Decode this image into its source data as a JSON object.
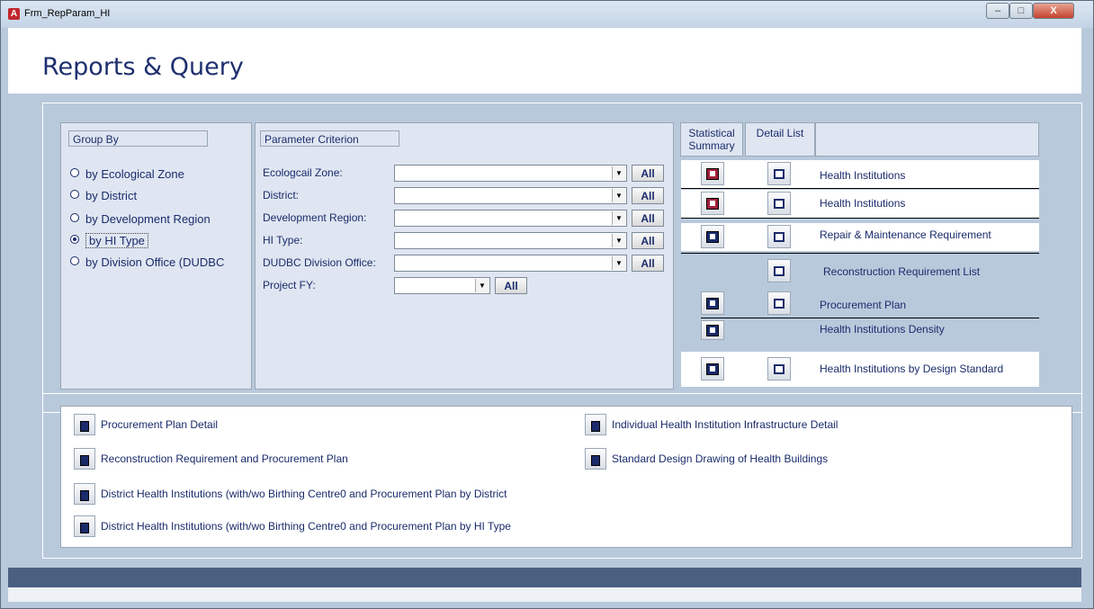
{
  "window": {
    "title": "Frm_RepParam_HI",
    "app_icon": "A",
    "minimize": "–",
    "maximize": "□",
    "close": "X"
  },
  "header": {
    "title": "Reports & Query"
  },
  "group_by": {
    "label": "Group By",
    "options": [
      {
        "label": "by Ecological Zone",
        "selected": false
      },
      {
        "label": "by District",
        "selected": false
      },
      {
        "label": "by Development Region",
        "selected": false
      },
      {
        "label": "by HI Type",
        "selected": true
      },
      {
        "label": "by Division Office (DUDBC",
        "selected": false
      }
    ]
  },
  "parameters": {
    "label": "Parameter Criterion",
    "all_label": "All",
    "fields": [
      {
        "label": "Ecologcail Zone:",
        "value": ""
      },
      {
        "label": "District:",
        "value": ""
      },
      {
        "label": "Development Region:",
        "value": ""
      },
      {
        "label": "HI Type:",
        "value": ""
      },
      {
        "label": "DUDBC Division Office:",
        "value": ""
      },
      {
        "label": "Project FY:",
        "value": ""
      }
    ]
  },
  "reports": {
    "col_stat": "Statistical Summary",
    "col_detail": "Detail List",
    "rows": [
      {
        "label": "Health Institutions"
      },
      {
        "label": "Health Institutions"
      },
      {
        "label": "Repair & Maintenance Requirement"
      },
      {
        "label": "Reconstruction Requirement List"
      },
      {
        "label": "Procurement Plan"
      },
      {
        "label": "Health Institutions Density"
      },
      {
        "label": "Health Institutions by Design Standard"
      }
    ]
  },
  "documents": {
    "left": [
      "Procurement Plan Detail",
      "Reconstruction Requirement and Procurement Plan",
      "District Health Institutions (with/wo Birthing Centre0 and Procurement Plan by District",
      "District Health Institutions (with/wo Birthing Centre0 and Procurement Plan by HI Type"
    ],
    "right": [
      "Individual Health Institution Infrastructure Detail",
      "Standard Design Drawing of Health Buildings"
    ]
  },
  "colors": {
    "form_bg": "#b9c9dc",
    "panel_bg": "#dfe6f1",
    "title_text": "#1e2f6e",
    "footer_bar": "#4a6080"
  }
}
